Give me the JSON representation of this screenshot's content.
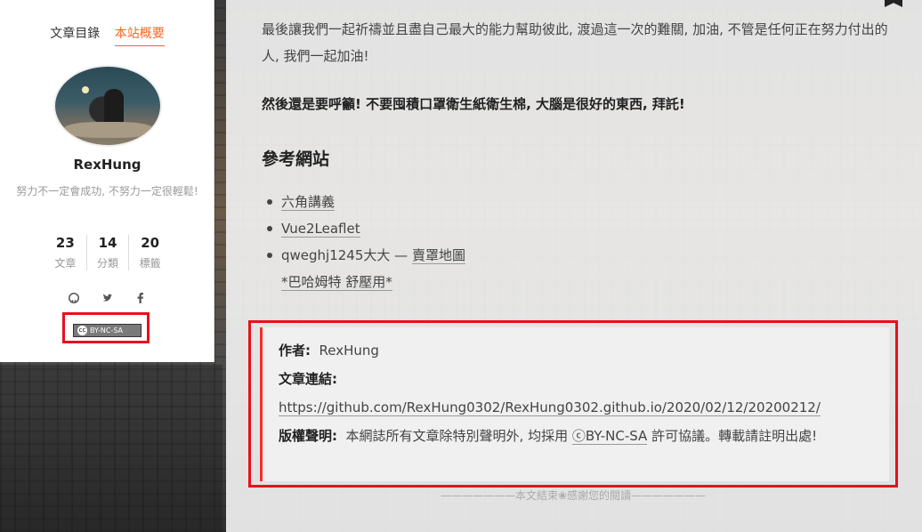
{
  "sidebar": {
    "tabs": [
      "文章目錄",
      "本站概要"
    ],
    "author_name": "RexHung",
    "author_desc": "努力不一定會成功, 不努力一定很輕鬆!",
    "stats": [
      {
        "count": "23",
        "label": "文章"
      },
      {
        "count": "14",
        "label": "分類"
      },
      {
        "count": "20",
        "label": "標籤"
      }
    ],
    "social_icons": [
      "github-icon",
      "twitter-icon",
      "facebook-icon"
    ],
    "cc_badge": "BY-NC-SA",
    "cc_icon_text": "cc"
  },
  "main": {
    "para1": "最後讓我們一起祈禱並且盡自己最大的能力幫助彼此, 渡過這一次的難關, 加油, 不管是任何正在努力付出的人, 我們一起加油!",
    "para2": "然後還是要呼籲! 不要囤積口罩衛生紙衛生棉, 大腦是很好的東西, 拜託!",
    "ref_heading": "參考網站",
    "refs": [
      {
        "text": "六角講義"
      },
      {
        "text": "Vue2Leaflet"
      },
      {
        "prefix": "qweghj1245大大 — ",
        "text": "賣罩地圖"
      },
      {
        "text": "*巴哈姆特 舒壓用*"
      }
    ],
    "copyright": {
      "author_label": "作者:",
      "author_value": "RexHung",
      "link_label": "文章連結:",
      "link_value": "https://github.com/RexHung0302/RexHung0302.github.io/2020/02/12/20200212/",
      "license_label": "版權聲明:",
      "license_pre": "本網誌所有文章除特別聲明外, 均採用",
      "license_link": "ⓒBY-NC-SA",
      "license_post": "許可協議。轉載請註明出處!"
    },
    "end_text": "———————本文結束❀感謝您的閱讀———————"
  },
  "colors": {
    "accent": "#fc6423",
    "highlight_red": "#e8101c"
  }
}
